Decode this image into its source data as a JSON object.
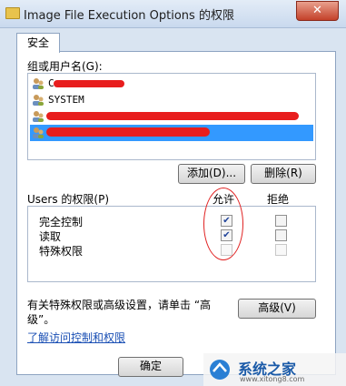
{
  "window": {
    "title": "Image File Execution Options 的权限",
    "close_glyph": "✕"
  },
  "tabs": [
    {
      "label": "安全"
    }
  ],
  "group_label": "组或用户名(G):",
  "users": [
    {
      "name": "C",
      "icon": "users-group-icon",
      "selected": false
    },
    {
      "name": "SYSTEM",
      "icon": "users-group-icon",
      "selected": false
    },
    {
      "name": "",
      "icon": "users-group-icon",
      "selected": false
    },
    {
      "name": "",
      "icon": "users-group-icon",
      "selected": true
    }
  ],
  "buttons": {
    "add": "添加(D)...",
    "remove": "删除(R)",
    "advanced": "高级(V)",
    "ok": "确定"
  },
  "permissions_header": {
    "title": "Users 的权限(P)",
    "allow": "允许",
    "deny": "拒绝"
  },
  "permissions": [
    {
      "name": "完全控制",
      "allow": true,
      "deny": false,
      "enabled": true
    },
    {
      "name": "读取",
      "allow": true,
      "deny": false,
      "enabled": true
    },
    {
      "name": "特殊权限",
      "allow": false,
      "deny": false,
      "enabled": false
    }
  ],
  "special_text_line1": "有关特殊权限或高级设置，请单击 “高",
  "special_text_line2": "级”。",
  "link_text": "了解访问控制和权限",
  "watermark": {
    "text": "系统之家",
    "url_hint": "www.xitong8.com"
  },
  "colors": {
    "selection": "#3399ff",
    "annotation_red": "#e81d1d",
    "link": "#1a4fb4"
  }
}
